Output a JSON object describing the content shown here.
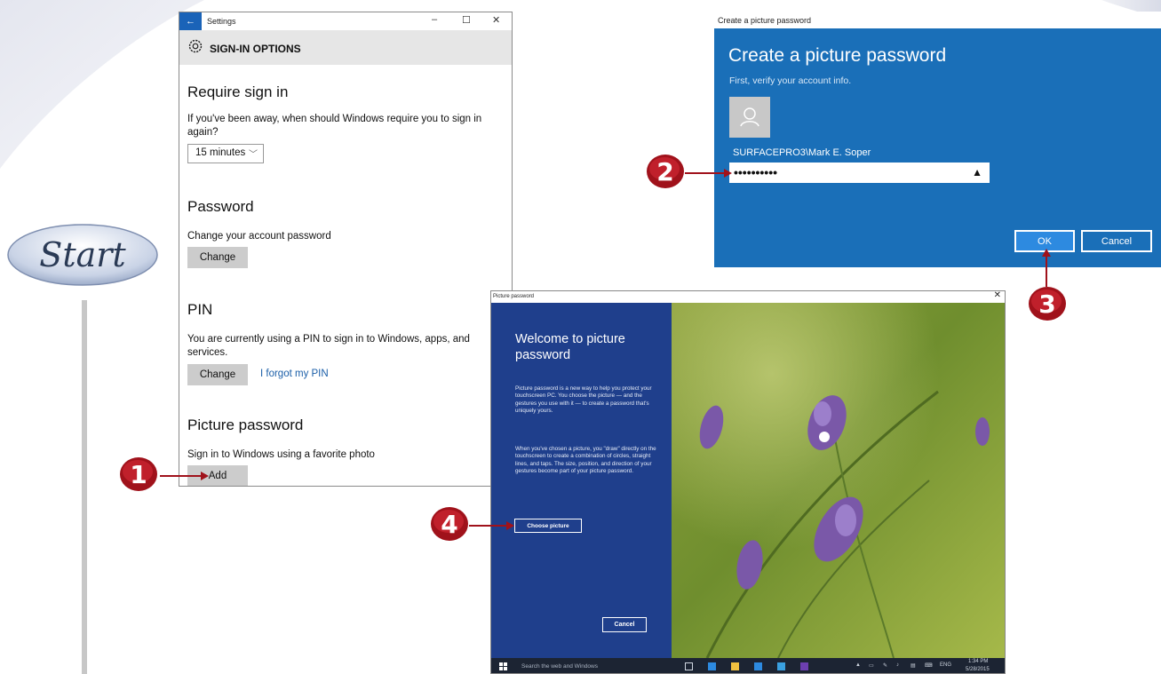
{
  "badge": {
    "start_label": "Start"
  },
  "settings": {
    "title": "Settings",
    "back_icon": "←",
    "minimize": "–",
    "maximize": "☐",
    "close": "✕",
    "header": "SIGN-IN OPTIONS",
    "require": {
      "heading": "Require sign in",
      "desc": "If you've been away, when should Windows require you to sign in again?",
      "select_value": "15 minutes"
    },
    "password": {
      "heading": "Password",
      "desc": "Change your account password",
      "button": "Change"
    },
    "pin": {
      "heading": "PIN",
      "desc": "You are currently using a PIN to sign in to Windows, apps, and services.",
      "button": "Change",
      "link": "I forgot my PIN"
    },
    "picture": {
      "heading": "Picture password",
      "desc": "Sign in to Windows using a favorite photo",
      "button": "Add"
    }
  },
  "verify": {
    "titlebar": "Create a picture password",
    "title": "Create a picture password",
    "subtitle": "First, verify your account info.",
    "username": "SURFACEPRO3\\Mark E. Soper",
    "password_mask": "••••••••••",
    "ok": "OK",
    "cancel": "Cancel"
  },
  "picture_window": {
    "titlebar": "Picture password",
    "close": "✕",
    "title": "Welcome to picture password",
    "para1": "Picture password is a new way to help you protect your touchscreen PC. You choose the picture — and the gestures you use with it — to create a password that's uniquely yours.",
    "para2": "When you've chosen a picture, you \"draw\" directly on the touchscreen to create a combination of circles, straight lines, and taps. The size, position, and direction of your gestures become part of your picture password.",
    "choose_button": "Choose picture",
    "cancel_button": "Cancel"
  },
  "taskbar": {
    "search_placeholder": "Search the web and Windows",
    "language": "ENG",
    "time": "1:34 PM",
    "date": "5/28/2015"
  },
  "callouts": [
    "1",
    "2",
    "3",
    "4"
  ],
  "colors": {
    "settings_accent": "#1a63b8",
    "verify_bg": "#1a6fb8",
    "picture_panel": "#1f3f8c",
    "callout_red": "#a0121b",
    "link": "#1a5ea8"
  }
}
